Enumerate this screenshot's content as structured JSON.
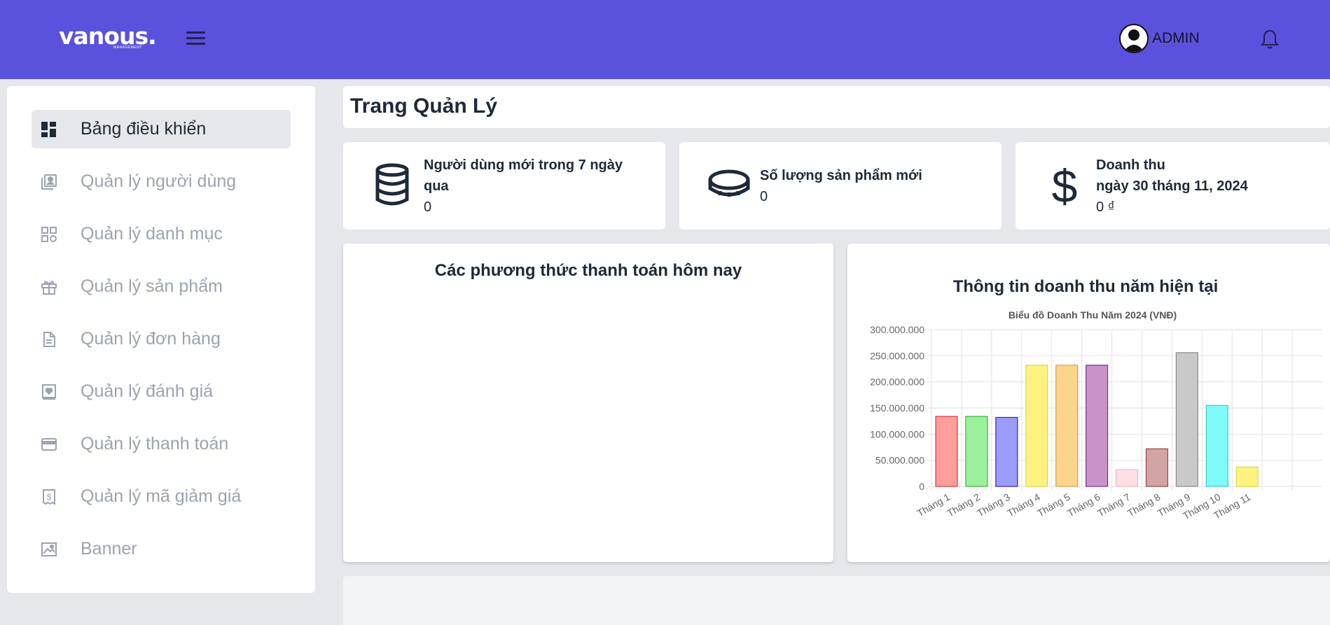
{
  "header": {
    "logo": "vanous.",
    "logo_sub": "MANAGEMENT",
    "user_name": "ADMIN"
  },
  "sidebar": {
    "items": [
      {
        "label": "Bảng điều khiển",
        "icon": "dashboard-icon",
        "active": true
      },
      {
        "label": "Quản lý người dùng",
        "icon": "user-card-icon"
      },
      {
        "label": "Quản lý danh mục",
        "icon": "grid-icon"
      },
      {
        "label": "Quản lý sản phẩm",
        "icon": "gift-icon"
      },
      {
        "label": "Quản lý đơn hàng",
        "icon": "document-icon"
      },
      {
        "label": "Quản lý đánh giá",
        "icon": "review-heart-icon"
      },
      {
        "label": "Quản lý thanh toán",
        "icon": "credit-card-icon"
      },
      {
        "label": "Quản lý mã giảm giá",
        "icon": "coupon-receipt-icon"
      },
      {
        "label": "Banner",
        "icon": "image-icon"
      }
    ]
  },
  "main": {
    "page_title": "Trang Quản Lý",
    "stats": [
      {
        "label": "Người dùng mới trong 7 ngày qua",
        "value": "0",
        "icon": "database-icon"
      },
      {
        "label": "Số lượng sản phẩm mới",
        "value": "0",
        "icon": "coin-icon"
      },
      {
        "label_line1": "Doanh thu",
        "label_line2": "ngày 30 tháng 11, 2024",
        "value": "0 ₫",
        "icon": "dollar-icon"
      }
    ],
    "payment_panel_title": "Các phương thức thanh toán hôm nay",
    "revenue_panel_title": "Thông tin doanh thu năm hiện tại"
  },
  "chart_data": {
    "type": "bar",
    "title": "Biểu đồ Doanh Thu Năm 2024 (VNĐ)",
    "categories": [
      "Tháng 1",
      "Tháng 2",
      "Tháng 3",
      "Tháng 4",
      "Tháng 5",
      "Tháng 6",
      "Tháng 7",
      "Tháng 8",
      "Tháng 9",
      "Tháng 10",
      "Tháng 11"
    ],
    "values": [
      134000000,
      134000000,
      132000000,
      232000000,
      232000000,
      232000000,
      32000000,
      72000000,
      256000000,
      155000000,
      37000000
    ],
    "ylim": [
      0,
      300000000
    ],
    "yticks": [
      "0",
      "50.000.000",
      "100.000.000",
      "150.000.000",
      "200.000.000",
      "250.000.000",
      "300.000.000"
    ],
    "grid": true,
    "fill_colors": [
      "#ff9c9c",
      "#9cf09c",
      "#9c9cff",
      "#fff280",
      "#fcd58c",
      "#c893c8",
      "#fde0e6",
      "#d3a4a4",
      "#c9c9c9",
      "#80f9f9",
      "#fff280"
    ],
    "border_colors": [
      "#d63a3a",
      "#39b339",
      "#2626c9",
      "#d9d94a",
      "#d9a24a",
      "#7a2b8c",
      "#f0b7c2",
      "#9c4343",
      "#8a8a8a",
      "#39c9c9",
      "#d9d94a"
    ]
  },
  "colors": {
    "topbar": "#5a52dc",
    "background": "#e5e7eb",
    "active_nav": "#e5e7eb",
    "muted_text": "#9ca3af"
  }
}
